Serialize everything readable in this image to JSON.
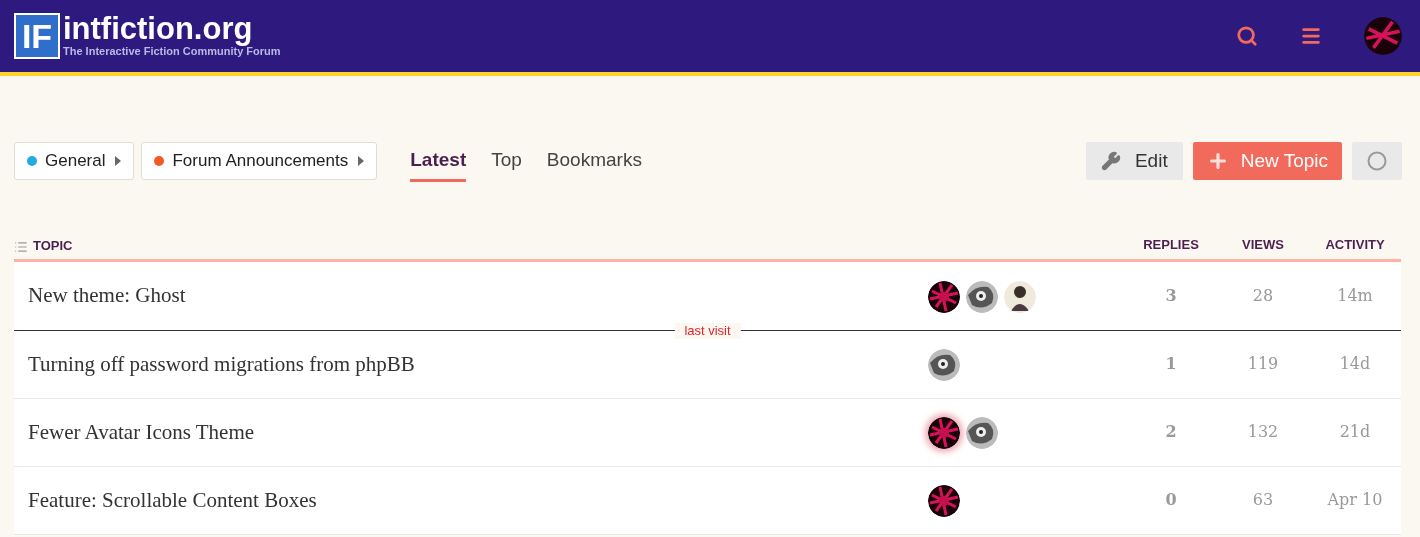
{
  "header": {
    "logo_mark": "IF",
    "site_name": "intfiction.org",
    "tagline": "The Interactive Fiction Community Forum"
  },
  "breadcrumbs": [
    {
      "label": "General",
      "color": "#25aae1"
    },
    {
      "label": "Forum Announcements",
      "color": "#f1592a"
    }
  ],
  "nav_tabs": [
    {
      "label": "Latest",
      "selected": true
    },
    {
      "label": "Top",
      "selected": false
    },
    {
      "label": "Bookmarks",
      "selected": false
    }
  ],
  "actions": {
    "edit": "Edit",
    "new_topic": "New Topic"
  },
  "table": {
    "columns": [
      "TOPIC",
      "REPLIES",
      "VIEWS",
      "ACTIVITY"
    ],
    "rows": [
      {
        "title": "New theme: Ghost",
        "posters": [
          {
            "kind": "red",
            "highlighted": false
          },
          {
            "kind": "gray",
            "highlighted": false
          },
          {
            "kind": "figure",
            "highlighted": false
          }
        ],
        "replies": "3",
        "views": "28",
        "activity": "14m",
        "last_visit_marker": "last visit"
      },
      {
        "title": "Turning off password migrations from phpBB",
        "posters": [
          {
            "kind": "gray",
            "highlighted": false
          }
        ],
        "replies": "1",
        "views": "119",
        "activity": "14d"
      },
      {
        "title": "Fewer Avatar Icons Theme",
        "posters": [
          {
            "kind": "red",
            "highlighted": true
          },
          {
            "kind": "gray",
            "highlighted": false
          }
        ],
        "replies": "2",
        "views": "132",
        "activity": "21d"
      },
      {
        "title": "Feature: Scrollable Content Boxes",
        "posters": [
          {
            "kind": "red",
            "highlighted": false
          }
        ],
        "replies": "0",
        "views": "63",
        "activity": "Apr 10"
      }
    ]
  }
}
